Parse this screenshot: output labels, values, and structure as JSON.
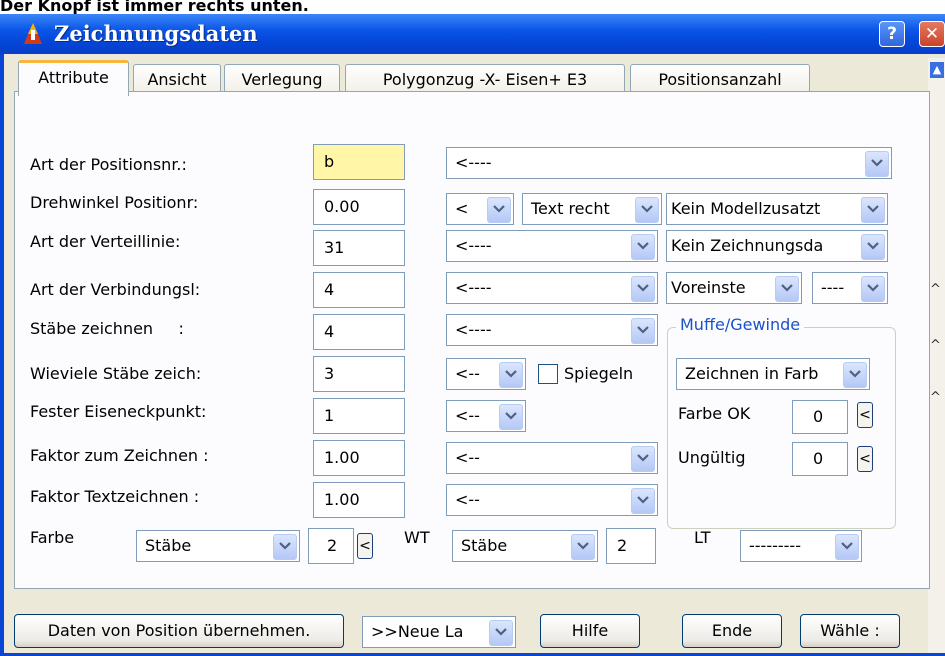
{
  "caption": "Der Knopf ist immer rechts unten.",
  "window": {
    "title": "Zeichnungsdaten",
    "help_label": "?",
    "close_label": "✕"
  },
  "tabs": [
    {
      "label": "Attribute",
      "active": true
    },
    {
      "label": "Ansicht"
    },
    {
      "label": "Verlegung"
    },
    {
      "label": "Polygonzug -X- Eisen+ E3"
    },
    {
      "label": "Positionsanzahl"
    }
  ],
  "rows": [
    {
      "label": "Art der Positionsnr.:",
      "value": "b"
    },
    {
      "label": "Drehwinkel Positionr:",
      "value": "0.00"
    },
    {
      "label": "Art der Verteillinie:",
      "value": "31"
    },
    {
      "label": "Art der Verbindungsl:",
      "value": "4"
    },
    {
      "label": "Stäbe zeichnen     :",
      "value": "4"
    },
    {
      "label": "Wieviele Stäbe zeich:",
      "value": "3"
    },
    {
      "label": "Fester Eiseneckpunkt:",
      "value": "1"
    },
    {
      "label": "Faktor zum Zeichnen :",
      "value": "1.00"
    },
    {
      "label": "Faktor Textzeichnen :",
      "value": "1.00"
    }
  ],
  "combos": {
    "positionsnr": "<----",
    "drehwinkel_dir": "<",
    "drehwinkel_text": "Text recht",
    "modellzusatz": "Kein Modellzusatzt",
    "verteillinie": "<----",
    "zeichnungsdaten": "Kein Zeichnungsda",
    "verbindungsl": "<----",
    "voreinst": "Voreinste",
    "dashes": "----",
    "staebe_zeichnen": "<----",
    "wieviele": "<--",
    "eiseneckpunkt": "<--",
    "faktor_zeichnen": "<--",
    "faktor_text": "<--"
  },
  "spiegeln_label": "Spiegeln",
  "muffe": {
    "title": "Muffe/Gewinde",
    "zeichnen": "Zeichnen in Farb",
    "farbe_ok_label": "Farbe OK",
    "farbe_ok_value": "0",
    "ungueltig_label": "Ungültig",
    "ungueltig_value": "0"
  },
  "farbe": {
    "label": "Farbe",
    "combo": "Stäbe",
    "value": "2",
    "wt_label": "WT",
    "wt_combo": "Stäbe",
    "wt_value": "2",
    "lt_label": "LT",
    "lt_combo": "---------"
  },
  "small_button_label": "<",
  "buttons": {
    "daten": "Daten von Position übernehmen.",
    "neue_lage": ">>Neue La",
    "hilfe": "Hilfe",
    "ende": "Ende",
    "waehle": "Wähle :"
  },
  "colors": {
    "title_bar": "#0b55e8",
    "highlight_field": "#fff6a8",
    "group_title": "#1a52c8"
  }
}
